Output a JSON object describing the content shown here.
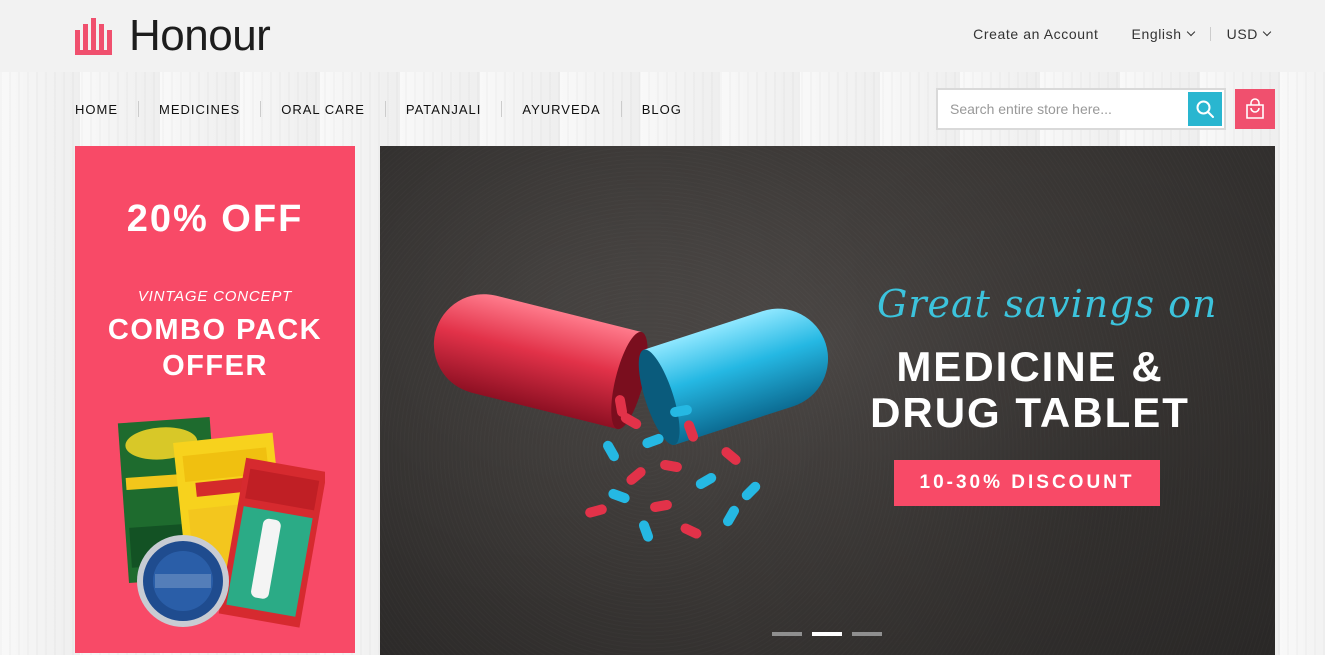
{
  "brand": {
    "name": "Honour"
  },
  "top_links": {
    "create_account": "Create an Account",
    "language": "English",
    "currency": "USD"
  },
  "nav": {
    "items": [
      "HOME",
      "MEDICINES",
      "ORAL CARE",
      "PATANJALI",
      "AYURVEDA",
      "BLOG"
    ]
  },
  "search": {
    "placeholder": "Search entire store here..."
  },
  "promo": {
    "off": "20% OFF",
    "vintage": "VINTAGE CONCEPT",
    "combo_line1": "COMBO PACK",
    "combo_line2": "OFFER"
  },
  "slide": {
    "script": "Great savings on",
    "title_line1": "MEDICINE &",
    "title_line2": "DRUG TABLET",
    "button": "10-30% DISCOUNT",
    "active_index": 2,
    "total": 3
  },
  "colors": {
    "accent_pink": "#f84a67",
    "accent_cyan": "#29b6d0"
  }
}
